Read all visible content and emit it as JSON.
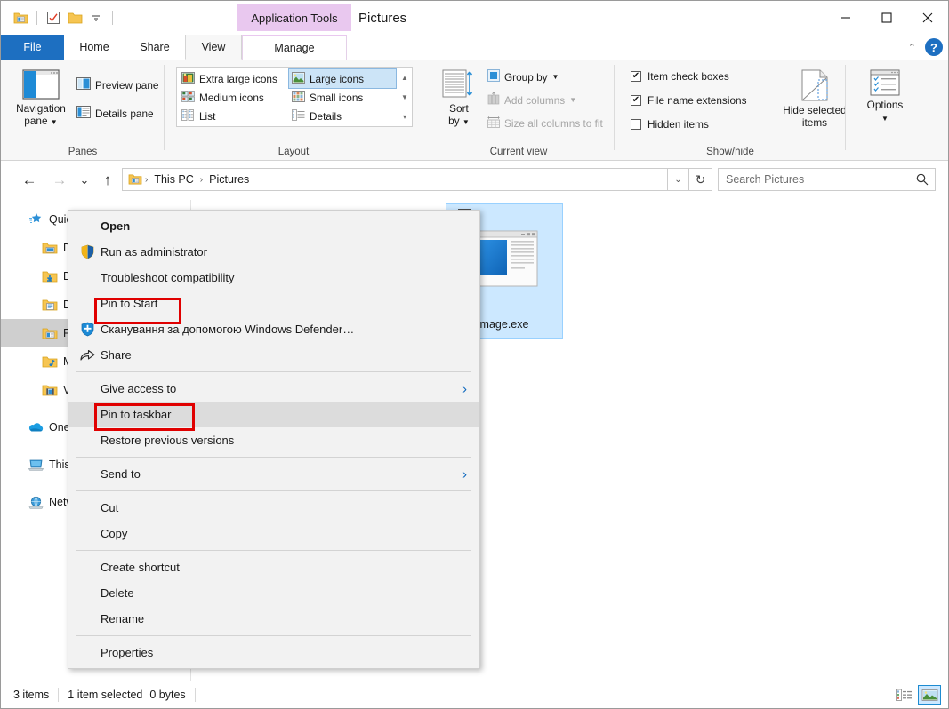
{
  "window": {
    "title": "Pictures",
    "contextual_tab_title": "Application Tools",
    "minimize": "─",
    "maximize": "☐",
    "close": "✕",
    "quick_access": [
      "pictures-folder-icon",
      "properties-checkbox-icon",
      "new-folder-icon",
      "customize-dropdown-icon"
    ]
  },
  "tabs": [
    {
      "label": "File",
      "id": "file"
    },
    {
      "label": "Home",
      "id": "home"
    },
    {
      "label": "Share",
      "id": "share"
    },
    {
      "label": "View",
      "id": "view"
    },
    {
      "label": "Manage",
      "id": "manage"
    }
  ],
  "ribbon_right": {
    "collapse": "⌃",
    "help": "?"
  },
  "ribbon": {
    "groups": [
      {
        "label": "Panes"
      },
      {
        "label": "Layout"
      },
      {
        "label": "Current view"
      },
      {
        "label": "Show/hide"
      }
    ],
    "panes": {
      "navigation_pane": "Navigation\npane",
      "navigation_pane_line1": "Navigation",
      "navigation_pane_line2": "pane",
      "preview_pane": "Preview pane",
      "details_pane": "Details pane"
    },
    "layout": {
      "items": [
        {
          "label": "Extra large icons",
          "selected": false
        },
        {
          "label": "Large icons",
          "selected": true
        },
        {
          "label": "Medium icons",
          "selected": false
        },
        {
          "label": "Small icons",
          "selected": false
        },
        {
          "label": "List",
          "selected": false
        },
        {
          "label": "Details",
          "selected": false
        }
      ],
      "scroll_up": "▲",
      "scroll_down": "▼",
      "scroll_more": "▼"
    },
    "current_view": {
      "sort_by_line1": "Sort",
      "sort_by_line2": "by",
      "group_by": "Group by",
      "add_columns": "Add columns",
      "size_all_columns": "Size all columns to fit"
    },
    "show_hide": {
      "item_check_boxes": {
        "label": "Item check boxes",
        "checked": true
      },
      "file_name_extensions": {
        "label": "File name extensions",
        "checked": true
      },
      "hidden_items": {
        "label": "Hidden items",
        "checked": false
      },
      "hide_selected_line1": "Hide selected",
      "hide_selected_line2": "items",
      "options": "Options"
    }
  },
  "addressbar": {
    "back": "←",
    "forward": "→",
    "recent": "⌄",
    "up": "↑",
    "breadcrumbs": [
      "This PC",
      "Pictures"
    ],
    "separator": "›",
    "dropdown": "⌄",
    "refresh": "↻",
    "search_placeholder": "Search Pictures",
    "search_value": ""
  },
  "sidebar": {
    "items": [
      {
        "label": "Quick access",
        "icon": "star-pin-icon",
        "indent": 0,
        "selected": false
      },
      {
        "label": "Desktop",
        "icon": "desktop-folder-icon",
        "indent": 1,
        "selected": false
      },
      {
        "label": "Downloads",
        "icon": "downloads-folder-icon",
        "indent": 1,
        "selected": false
      },
      {
        "label": "Documents",
        "icon": "documents-folder-icon",
        "indent": 1,
        "selected": false
      },
      {
        "label": "Pictures",
        "icon": "pictures-folder-icon",
        "indent": 1,
        "selected": true
      },
      {
        "label": "Music",
        "icon": "music-folder-icon",
        "indent": 1,
        "selected": false
      },
      {
        "label": "Videos",
        "icon": "videos-folder-icon",
        "indent": 1,
        "selected": false
      },
      {
        "label": "OneDrive",
        "icon": "onedrive-cloud-icon",
        "indent": 0,
        "selected": false
      },
      {
        "label": "This PC",
        "icon": "this-pc-icon",
        "indent": 0,
        "selected": false
      },
      {
        "label": "Network",
        "icon": "network-icon",
        "indent": 0,
        "selected": false
      }
    ]
  },
  "files": [
    {
      "name": "mage.exe",
      "icon": "application-exe-icon",
      "selected": true,
      "checked": false
    }
  ],
  "context_menu": {
    "items": [
      {
        "label": "Open",
        "bold": true,
        "icon": null,
        "submenu": false
      },
      {
        "label": "Run as administrator",
        "bold": false,
        "icon": "uac-shield-icon",
        "submenu": false
      },
      {
        "label": "Troubleshoot compatibility",
        "bold": false,
        "icon": null,
        "submenu": false
      },
      {
        "label": "Pin to Start",
        "bold": false,
        "icon": null,
        "submenu": false,
        "highlight_box": true
      },
      {
        "label": "Сканування за допомогою Windows Defender…",
        "bold": false,
        "icon": "windows-defender-icon",
        "submenu": false
      },
      {
        "label": "Share",
        "bold": false,
        "icon": "share-icon",
        "submenu": false
      },
      {
        "separator": true
      },
      {
        "label": "Give access to",
        "bold": false,
        "icon": null,
        "submenu": true
      },
      {
        "label": "Pin to taskbar",
        "bold": false,
        "icon": null,
        "submenu": false,
        "hovered": true,
        "highlight_box": true
      },
      {
        "label": "Restore previous versions",
        "bold": false,
        "icon": null,
        "submenu": false
      },
      {
        "separator": true
      },
      {
        "label": "Send to",
        "bold": false,
        "icon": null,
        "submenu": true
      },
      {
        "separator": true
      },
      {
        "label": "Cut",
        "bold": false,
        "icon": null,
        "submenu": false
      },
      {
        "label": "Copy",
        "bold": false,
        "icon": null,
        "submenu": false
      },
      {
        "separator": true
      },
      {
        "label": "Create shortcut",
        "bold": false,
        "icon": null,
        "submenu": false
      },
      {
        "label": "Delete",
        "bold": false,
        "icon": null,
        "submenu": false
      },
      {
        "label": "Rename",
        "bold": false,
        "icon": null,
        "submenu": false
      },
      {
        "separator": true
      },
      {
        "label": "Properties",
        "bold": false,
        "icon": null,
        "submenu": false
      }
    ],
    "submenu_arrow": "›"
  },
  "statusbar": {
    "item_count": "3 items",
    "selection": "1 item selected",
    "size": "0 bytes",
    "view_details": "details-view-button",
    "view_large_icons": "large-icons-view-button"
  },
  "colors": {
    "accent": "#1d6fc1",
    "contextual_tab": "#e9c8ef",
    "selection": "#cce8ff",
    "highlight_red": "#e00000",
    "ribbon_bg": "#f7f7f7",
    "menu_bg": "#f2f2f2"
  }
}
